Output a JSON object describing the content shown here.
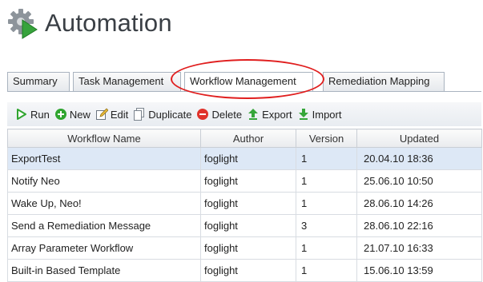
{
  "header": {
    "title": "Automation"
  },
  "tabs": [
    {
      "label": "Summary",
      "active": false
    },
    {
      "label": "Task Management",
      "active": false
    },
    {
      "label": "Workflow Management",
      "active": true
    },
    {
      "label": "Remediation Mapping",
      "active": false
    }
  ],
  "toolbar": {
    "run": "Run",
    "new": "New",
    "edit": "Edit",
    "duplicate": "Duplicate",
    "delete": "Delete",
    "export": "Export",
    "import": "Import"
  },
  "table": {
    "columns": [
      "Workflow Name",
      "Author",
      "Version",
      "Updated"
    ],
    "rows": [
      [
        "ExportTest",
        "foglight",
        "1",
        "20.04.10 18:36"
      ],
      [
        "Notify Neo",
        "foglight",
        "1",
        "25.06.10 10:50"
      ],
      [
        "Wake Up, Neo!",
        "foglight",
        "1",
        "28.06.10 14:26"
      ],
      [
        "Send a Remediation Message",
        "foglight",
        "3",
        "28.06.10 22:16"
      ],
      [
        "Array Parameter Workflow",
        "foglight",
        "1",
        "21.07.10 16:33"
      ],
      [
        "Built-in Based Template",
        "foglight",
        "1",
        "15.06.10 13:59"
      ]
    ],
    "selected_row": 0
  },
  "colors": {
    "highlight": "#e01e1e",
    "selected_row": "#dde8f6",
    "accent_green": "#2fa52f"
  }
}
